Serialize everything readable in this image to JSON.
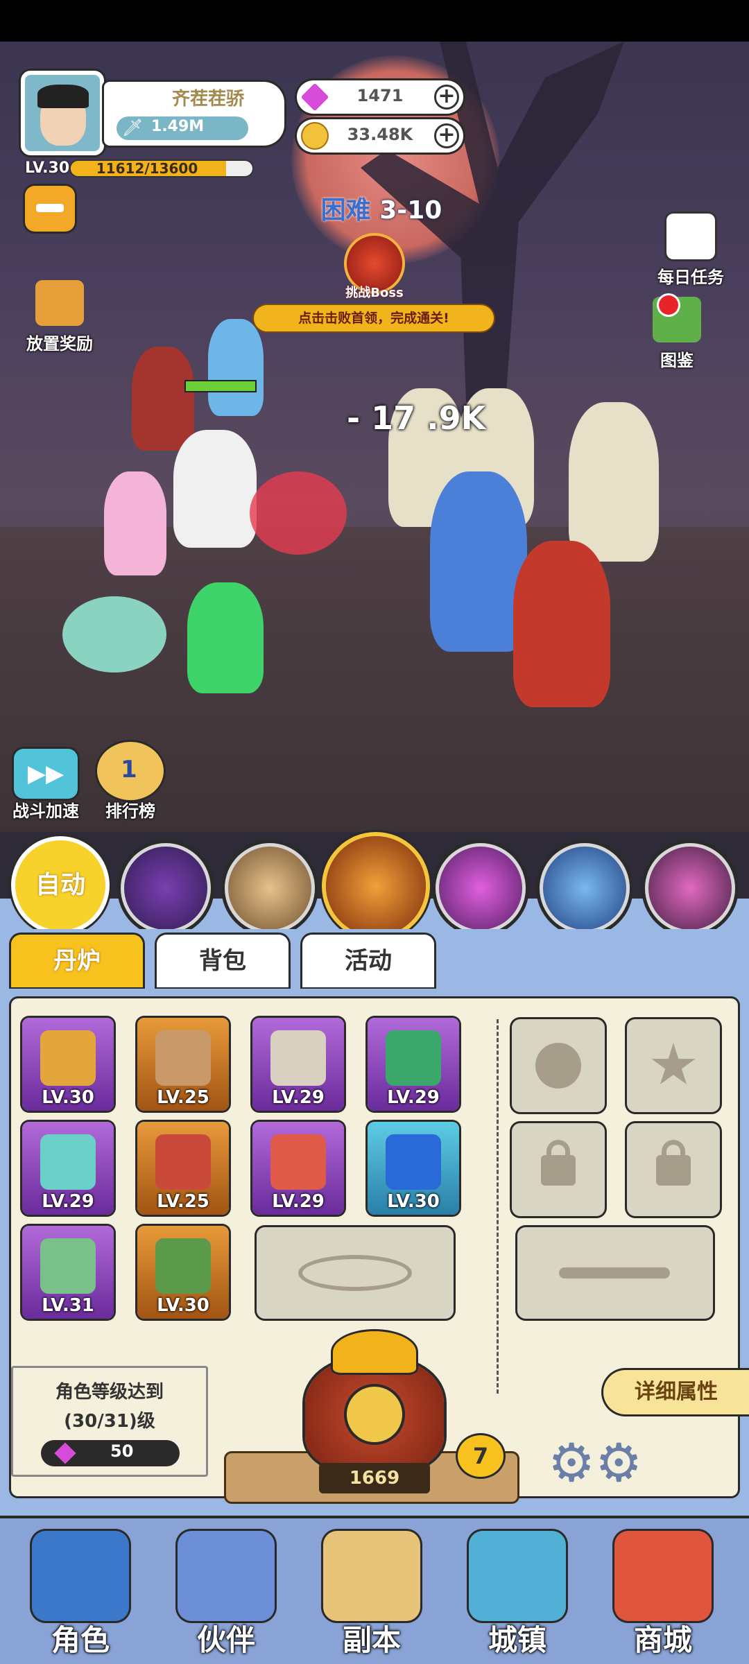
{
  "player": {
    "name": "齐茬茬骄",
    "power": "1.49M",
    "level": "LV.30",
    "xp": "11612/13600",
    "xp_fraction": 0.854
  },
  "currency": {
    "gems": "1471",
    "coins": "33.48K"
  },
  "stage": {
    "difficulty": "困难",
    "number": "3-10",
    "boss_label": "挑战Boss",
    "hint": "点击击败首领，完成通关!"
  },
  "battle": {
    "damage": "- 17 .9K"
  },
  "side_buttons": {
    "idle_reward": "放置奖励",
    "daily_task": "每日任务",
    "codex": "图鉴",
    "speed_up": "战斗加速",
    "ranking": "排行榜"
  },
  "skills": {
    "auto_label": "自动"
  },
  "tabs": [
    {
      "label": "丹炉",
      "active": true
    },
    {
      "label": "背包",
      "active": false
    },
    {
      "label": "活动",
      "active": false
    }
  ],
  "equipment": [
    {
      "level": "LV.30",
      "rarity": "purple",
      "icon": "spear-icon"
    },
    {
      "level": "LV.25",
      "rarity": "orange",
      "icon": "scroll-icon"
    },
    {
      "level": "LV.29",
      "rarity": "purple",
      "icon": "robe-icon"
    },
    {
      "level": "LV.29",
      "rarity": "purple",
      "icon": "dragon-orb-icon"
    },
    {
      "level": "LV.29",
      "rarity": "purple",
      "icon": "sword-icon"
    },
    {
      "level": "LV.25",
      "rarity": "orange",
      "icon": "shield-icon"
    },
    {
      "level": "LV.29",
      "rarity": "purple",
      "icon": "gourd-icon"
    },
    {
      "level": "LV.30",
      "rarity": "blue",
      "icon": "pearl-icon"
    },
    {
      "level": "LV.31",
      "rarity": "purple",
      "icon": "ring-icon"
    },
    {
      "level": "LV.30",
      "rarity": "orange",
      "icon": "boots-icon"
    }
  ],
  "unlock_info": {
    "line1": "角色等级达到",
    "line2": "(30/31)级",
    "reward": "50"
  },
  "detail_button": "详细属性",
  "furnace": {
    "count": "1669",
    "level": "7"
  },
  "nav": [
    {
      "label": "角色",
      "color": "#3b78c9"
    },
    {
      "label": "伙伴",
      "color": "#6c8fd8"
    },
    {
      "label": "副本",
      "color": "#e8c37a"
    },
    {
      "label": "城镇",
      "color": "#52b0d6"
    },
    {
      "label": "商城",
      "color": "#e0563c"
    }
  ]
}
